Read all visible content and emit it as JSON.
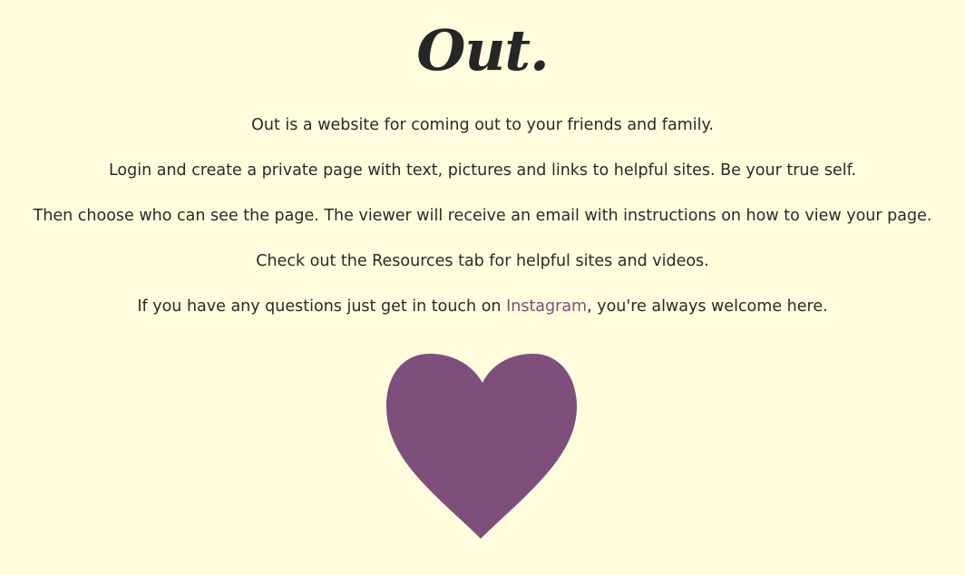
{
  "page": {
    "title": "Out."
  },
  "intro": {
    "p1": "Out is a website for coming out to your friends and family.",
    "p2": "Login and create a private page with text, pictures and links to helpful sites. Be your true self.",
    "p3": "Then choose who can see the page. The viewer will receive an email with instructions on how to view your page.",
    "p4": "Check out the Resources tab for helpful sites and videos.",
    "p5_before": "If you have any questions just get in touch on ",
    "p5_link": "Instagram",
    "p5_after": ", you're always welcome here."
  },
  "colors": {
    "background": "#fefcdc",
    "text": "#2a2a2a",
    "accent": "#7e4f7b"
  },
  "icons": {
    "heart": "heart-icon"
  }
}
